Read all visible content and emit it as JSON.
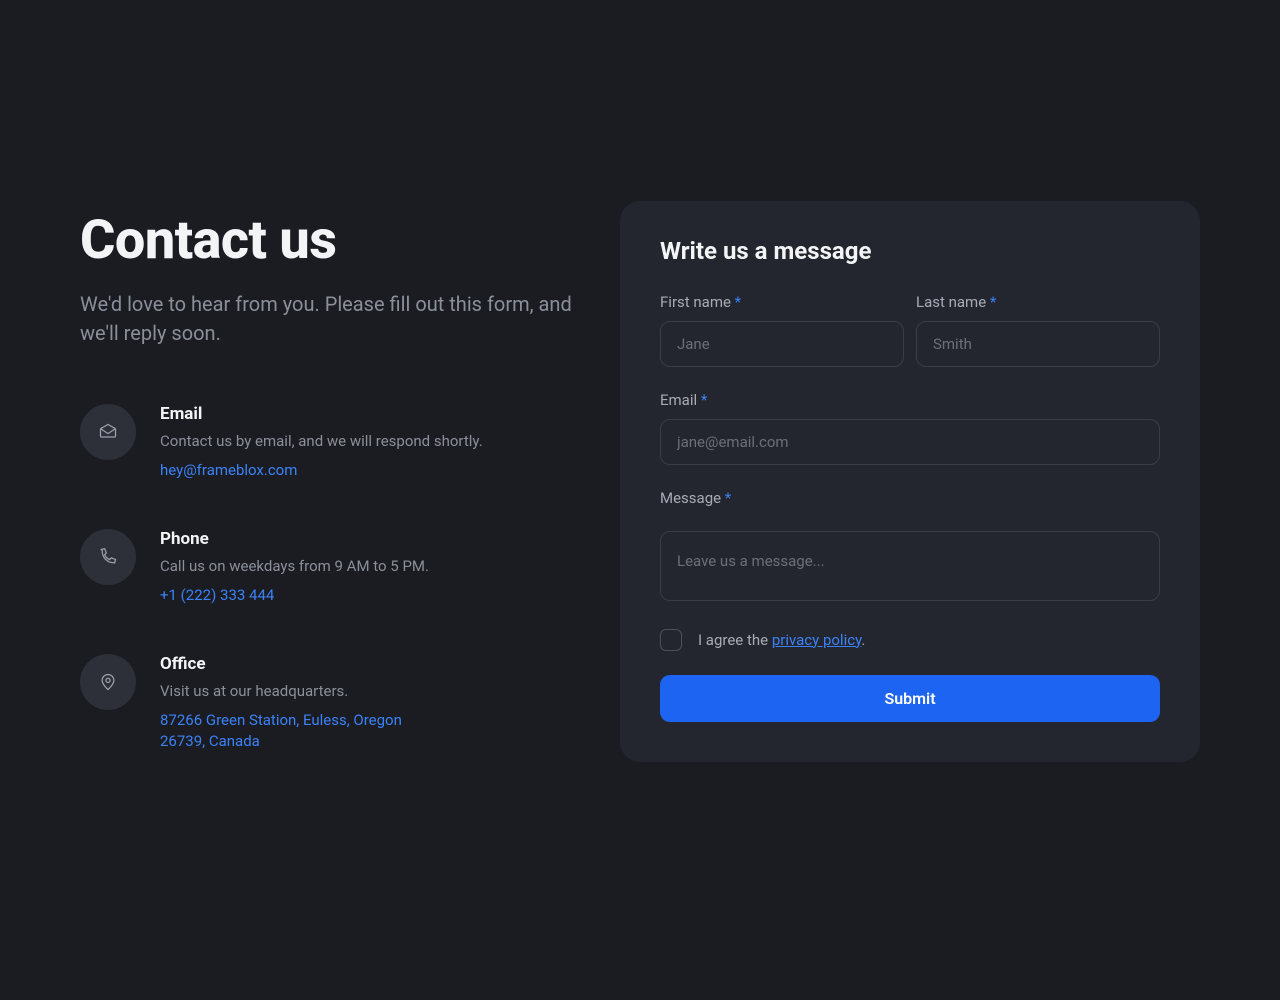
{
  "left": {
    "title": "Contact us",
    "subtitle": "We'd love to hear from you. Please fill out this form, and we'll reply soon.",
    "items": [
      {
        "heading": "Email",
        "desc": "Contact us by email, and we will respond shortly.",
        "link": "hey@frameblox.com",
        "icon": "envelope-icon"
      },
      {
        "heading": "Phone",
        "desc": "Call us on weekdays from 9 AM to 5 PM.",
        "link": "+1 (222) 333 444",
        "icon": "phone-icon"
      },
      {
        "heading": "Office",
        "desc": "Visit us at our headquarters.",
        "link": "87266 Green Station, Euless, Oregon 26739, Canada",
        "icon": "map-pin-icon"
      }
    ]
  },
  "form": {
    "title": "Write us a message",
    "required_mark": "*",
    "fields": {
      "first_name": {
        "label": "First name ",
        "placeholder": "Jane"
      },
      "last_name": {
        "label": "Last name ",
        "placeholder": "Smith"
      },
      "email": {
        "label": "Email ",
        "placeholder": "jane@email.com"
      },
      "message": {
        "label": "Message ",
        "placeholder": "Leave us a message..."
      }
    },
    "consent": {
      "prefix": "I agree the ",
      "policy": "privacy policy",
      "suffix": "."
    },
    "submit_label": "Submit"
  }
}
